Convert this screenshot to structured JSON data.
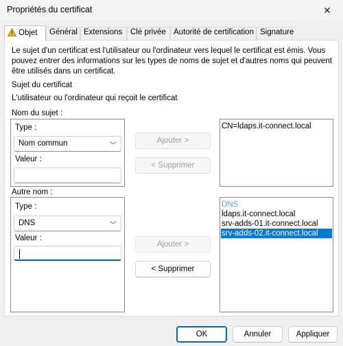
{
  "window": {
    "title": "Propriétés du certificat"
  },
  "tabs": [
    {
      "label": "Objet",
      "active": true,
      "icon": "warning-icon"
    },
    {
      "label": "Général"
    },
    {
      "label": "Extensions"
    },
    {
      "label": "Clé privée"
    },
    {
      "label": "Autorité de certification"
    },
    {
      "label": "Signature"
    }
  ],
  "intro": "Le sujet d'un certificat est l'utilisateur ou l'ordinateur vers lequel le certificat est émis. Vous pouvez entrer des informations sur les types de noms de sujet et d'autres noms qui peuvent être utilisés dans un certificat.",
  "subject": {
    "heading": "Sujet du certificat",
    "description": "L'utilisateur ou l'ordinateur qui reçoit le certificat"
  },
  "subject_name": {
    "group_label": "Nom du sujet :",
    "type_label": "Type :",
    "type_value": "Nom commun",
    "value_label": "Valeur :",
    "value_text": "",
    "add_button": "Ajouter >",
    "remove_button": "< Supprimer",
    "add_enabled": false,
    "remove_enabled": false,
    "list": [
      "CN=ldaps.it-connect.local"
    ]
  },
  "alt_name": {
    "group_label": "Autre nom :",
    "type_label": "Type :",
    "type_value": "DNS",
    "value_label": "Valeur :",
    "value_text": "",
    "add_button": "Ajouter >",
    "remove_button": "< Supprimer",
    "add_enabled": false,
    "remove_enabled": true,
    "list_header": "DNS",
    "list": [
      "ldaps.it-connect.local",
      "srv-adds-01.it-connect.local",
      "srv-adds-02.it-connect.local"
    ],
    "selected": "srv-adds-02.it-connect.local"
  },
  "footer": {
    "ok": "OK",
    "cancel": "Annuler",
    "apply": "Appliquer"
  },
  "colors": {
    "accent": "#0078d7",
    "selection": "#0078d7",
    "list_header": "#5aa9e6",
    "warning": "#f5c000"
  }
}
